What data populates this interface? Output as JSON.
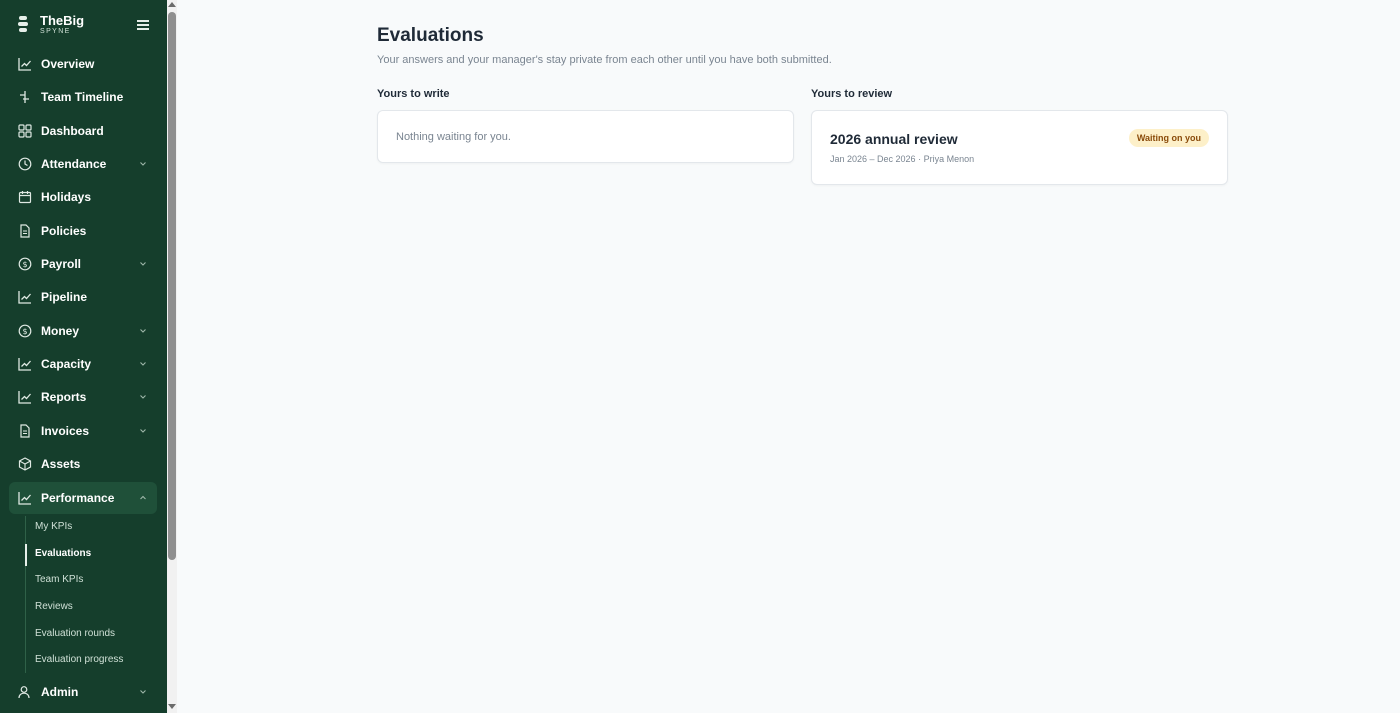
{
  "brand": {
    "name": "TheBig",
    "sub": "SPYNE"
  },
  "sidebar": {
    "items": [
      {
        "label": "Overview",
        "icon": "chart-line-icon"
      },
      {
        "label": "Team Timeline",
        "icon": "timeline-icon"
      },
      {
        "label": "Dashboard",
        "icon": "grid-icon"
      },
      {
        "label": "Attendance",
        "icon": "clock-icon",
        "expandable": true
      },
      {
        "label": "Holidays",
        "icon": "calendar-icon"
      },
      {
        "label": "Policies",
        "icon": "document-icon"
      },
      {
        "label": "Payroll",
        "icon": "dollar-circle-icon",
        "expandable": true
      },
      {
        "label": "Pipeline",
        "icon": "chart-line-icon"
      },
      {
        "label": "Money",
        "icon": "dollar-circle-icon",
        "expandable": true
      },
      {
        "label": "Capacity",
        "icon": "chart-line-icon",
        "expandable": true
      },
      {
        "label": "Reports",
        "icon": "chart-line-icon",
        "expandable": true
      },
      {
        "label": "Invoices",
        "icon": "document-icon",
        "expandable": true
      },
      {
        "label": "Assets",
        "icon": "box-icon"
      },
      {
        "label": "Performance",
        "icon": "chart-line-icon",
        "expandable": true,
        "expanded": true,
        "active": true
      },
      {
        "label": "Admin",
        "icon": "user-icon",
        "expandable": true
      }
    ],
    "performance_sub": [
      {
        "label": "My KPIs"
      },
      {
        "label": "Evaluations",
        "active": true
      },
      {
        "label": "Team KPIs"
      },
      {
        "label": "Reviews"
      },
      {
        "label": "Evaluation rounds"
      },
      {
        "label": "Evaluation progress"
      }
    ]
  },
  "page": {
    "title": "Evaluations",
    "subtitle": "Your answers and your manager's stay private from each other until you have both submitted."
  },
  "write": {
    "title": "Yours to write",
    "empty": "Nothing waiting for you."
  },
  "review": {
    "title": "Yours to review",
    "card": {
      "title": "2026 annual review",
      "meta": "Jan 2026 – Dec 2026 · Priya Menon",
      "badge": "Waiting on you"
    }
  },
  "colors": {
    "sidebar_bg": "#153e2c",
    "active_bg": "#1f5039",
    "badge_bg": "#fdf0c9",
    "badge_text": "#8a4b0a",
    "page_bg": "#f8fafb"
  }
}
